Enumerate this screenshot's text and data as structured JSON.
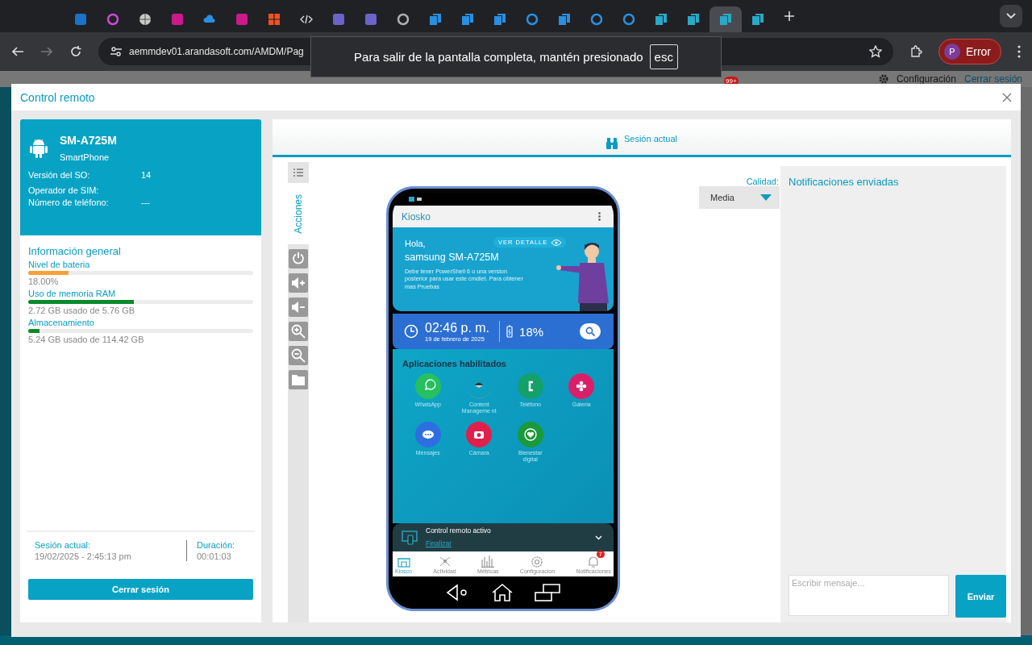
{
  "browser": {
    "tabs": [
      {
        "kind": "square",
        "color": "#1a73c8",
        "selected": false
      },
      {
        "kind": "ring",
        "color": "#c74bd6",
        "selected": false
      },
      {
        "kind": "globe",
        "color": "#c8c8c8",
        "selected": false
      },
      {
        "kind": "square",
        "color": "#cc1a8a",
        "selected": false
      },
      {
        "kind": "cloud",
        "color": "#2a8fe0",
        "selected": false
      },
      {
        "kind": "square",
        "color": "#cc1a8a",
        "selected": false
      },
      {
        "kind": "grid",
        "color": "#f25022",
        "selected": false
      },
      {
        "kind": "code",
        "color": "#cfcfcf",
        "selected": false
      },
      {
        "kind": "square",
        "color": "#6b63c9",
        "selected": false
      },
      {
        "kind": "square",
        "color": "#6b63c9",
        "selected": false
      },
      {
        "kind": "ring",
        "color": "#b0b0b0",
        "selected": false
      },
      {
        "kind": "page",
        "color": "#2a8fe0",
        "selected": false
      },
      {
        "kind": "page",
        "color": "#2a8fe0",
        "selected": false
      },
      {
        "kind": "page",
        "color": "#2a8fe0",
        "selected": false
      },
      {
        "kind": "ring",
        "color": "#2a8fe0",
        "selected": false
      },
      {
        "kind": "page",
        "color": "#2a8fe0",
        "selected": false
      },
      {
        "kind": "ring",
        "color": "#2a8fe0",
        "selected": false
      },
      {
        "kind": "ring",
        "color": "#2a8fe0",
        "selected": false
      },
      {
        "kind": "page",
        "color": "#2aa8c8",
        "selected": false
      },
      {
        "kind": "page",
        "color": "#2aa8c8",
        "selected": false
      },
      {
        "kind": "page",
        "color": "#2aa8c8",
        "selected": true
      },
      {
        "kind": "page",
        "color": "#2aa8c8",
        "selected": false
      }
    ],
    "url": "aemmdev01.arandasoft.com/AMDM/Pag",
    "toast": {
      "text": "Para salir de la pantalla completa, mantén presionado",
      "key": "esc"
    },
    "profile": {
      "initial": "P",
      "label": "Error"
    }
  },
  "app_header": {
    "badge": "99+",
    "links": [
      "Configuración",
      "Cerrar sesión"
    ]
  },
  "modal": {
    "title": "Control remoto",
    "device": {
      "name": "SM-A725M",
      "type": "SmartPhone",
      "fields": [
        {
          "label": "Versión del SO:",
          "value": "14"
        },
        {
          "label": "Operador de SIM:"
        },
        {
          "label": "Número de teléfono:",
          "value": "---"
        }
      ]
    },
    "general": {
      "title": "Información general",
      "metrics": [
        {
          "label": "Nivel de bateria",
          "level": 0.18,
          "reading": "18.00%",
          "color": "#f7a13a"
        },
        {
          "label": "Uso de memoria RAM",
          "level": 0.47,
          "reading": "2.72 GB usado de 5.76 GB",
          "color": "#0b8a2c"
        },
        {
          "label": "Almacenamiento",
          "level": 0.05,
          "reading": "5.24 GB usado de 114.42 GB",
          "color": "#0b8a2c"
        }
      ]
    },
    "session": {
      "label": "Sesión actual:",
      "value": "19/02/2025 - 2:45:13 pm"
    },
    "duration": {
      "label": "Duración:",
      "value": "00:01:03"
    },
    "logout": "Cerrar sesión",
    "tabs": [
      {
        "label": "Sesión actual",
        "selected": true
      }
    ],
    "actions": {
      "label": "Acciones",
      "buttons": [
        {
          "kind": "power"
        },
        {
          "kind": "volume-up"
        },
        {
          "kind": "volume-down"
        },
        {
          "kind": "zoom-in"
        },
        {
          "kind": "zoom-out"
        },
        {
          "kind": "folder"
        }
      ]
    },
    "quality": {
      "label": "Calidad:",
      "value": "Media"
    },
    "notifications": {
      "title": "Notificaciones enviadas",
      "placeholder": "Escribir mensaje...",
      "send": "Enviar"
    }
  },
  "phone": {
    "app_title": "Kiosko",
    "greeting": "Hola,",
    "device": "samsung SM-A725M",
    "detail": "VER DETALLE",
    "message": "Debe tener PowerShell 6 o una version posterior para usar este cmdlet. Para obtener mas Pruebas",
    "time": "02:46 p. m.",
    "date": "19 de febrero de 2025",
    "battery": "18%",
    "apps_title": "Aplicaciones habilitados",
    "apps": [
      {
        "name": "WhatsApp",
        "kind": "chat",
        "color": "#25c060"
      },
      {
        "name": "Content Manageme nt",
        "kind": "hat",
        "color": "#2aa0c0"
      },
      {
        "name": "Teléfono",
        "kind": "phone",
        "color": "#14a06a"
      },
      {
        "name": "Galería",
        "kind": "flower",
        "color": "#d8206a"
      },
      {
        "name": "Mensajes",
        "kind": "dots",
        "color": "#2d6fe0"
      },
      {
        "name": "Cámara",
        "kind": "camera",
        "color": "#e0204a"
      },
      {
        "name": "Bienestar digital",
        "kind": "heart",
        "color": "#1a9a3a"
      }
    ],
    "remote": {
      "text": "Control remoto activo",
      "link": "Finalizar"
    },
    "nav": [
      {
        "label": "Kiosco",
        "selected": true
      },
      {
        "label": "Actividad",
        "selected": false
      },
      {
        "label": "Métricas",
        "selected": false
      },
      {
        "label": "Configuracion",
        "selected": false
      },
      {
        "label": "Notificaciones",
        "selected": false,
        "badge": "7"
      }
    ]
  }
}
